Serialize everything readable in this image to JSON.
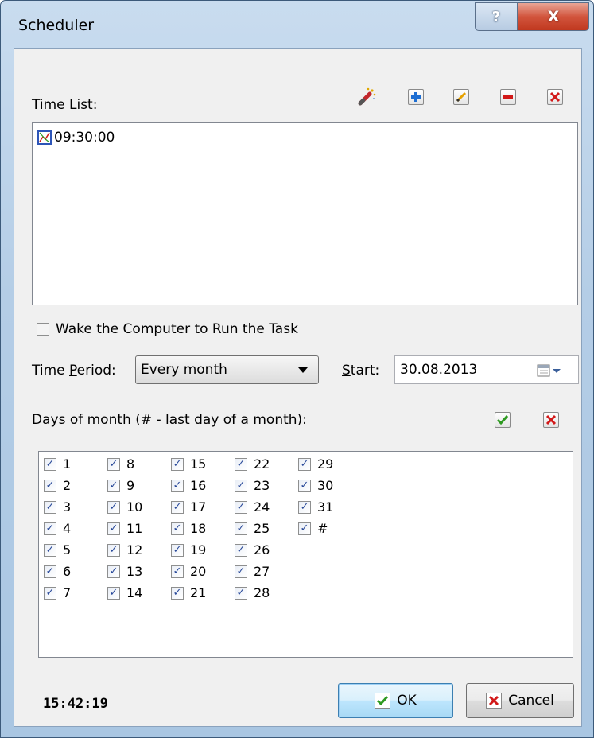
{
  "window": {
    "title": "Scheduler",
    "help_glyph": "?",
    "close_glyph": "X"
  },
  "toolbar": {
    "icons": [
      "wizard-icon",
      "add-icon",
      "edit-icon",
      "remove-icon",
      "delete-icon"
    ]
  },
  "time_list": {
    "label": "Time List:",
    "items": [
      "09:30:00"
    ]
  },
  "wake": {
    "label": "Wake the Computer to Run the Task",
    "checked": false
  },
  "time_period": {
    "label": "Time Period:",
    "value": "Every month"
  },
  "start": {
    "label": "Start:",
    "value": "30.08.2013"
  },
  "days": {
    "label": "Days of month (# - last day of a month):",
    "items": [
      "1",
      "2",
      "3",
      "4",
      "5",
      "6",
      "7",
      "8",
      "9",
      "10",
      "11",
      "12",
      "13",
      "14",
      "15",
      "16",
      "17",
      "18",
      "19",
      "20",
      "21",
      "22",
      "23",
      "24",
      "25",
      "26",
      "27",
      "28",
      "29",
      "30",
      "31",
      "#"
    ],
    "all_checked": true
  },
  "footer": {
    "clock": "15:42:19",
    "ok": "OK",
    "cancel": "Cancel"
  },
  "colors": {
    "accent": "#1e6ed2",
    "check_green": "#2e9a21",
    "delete_red": "#d21919"
  }
}
